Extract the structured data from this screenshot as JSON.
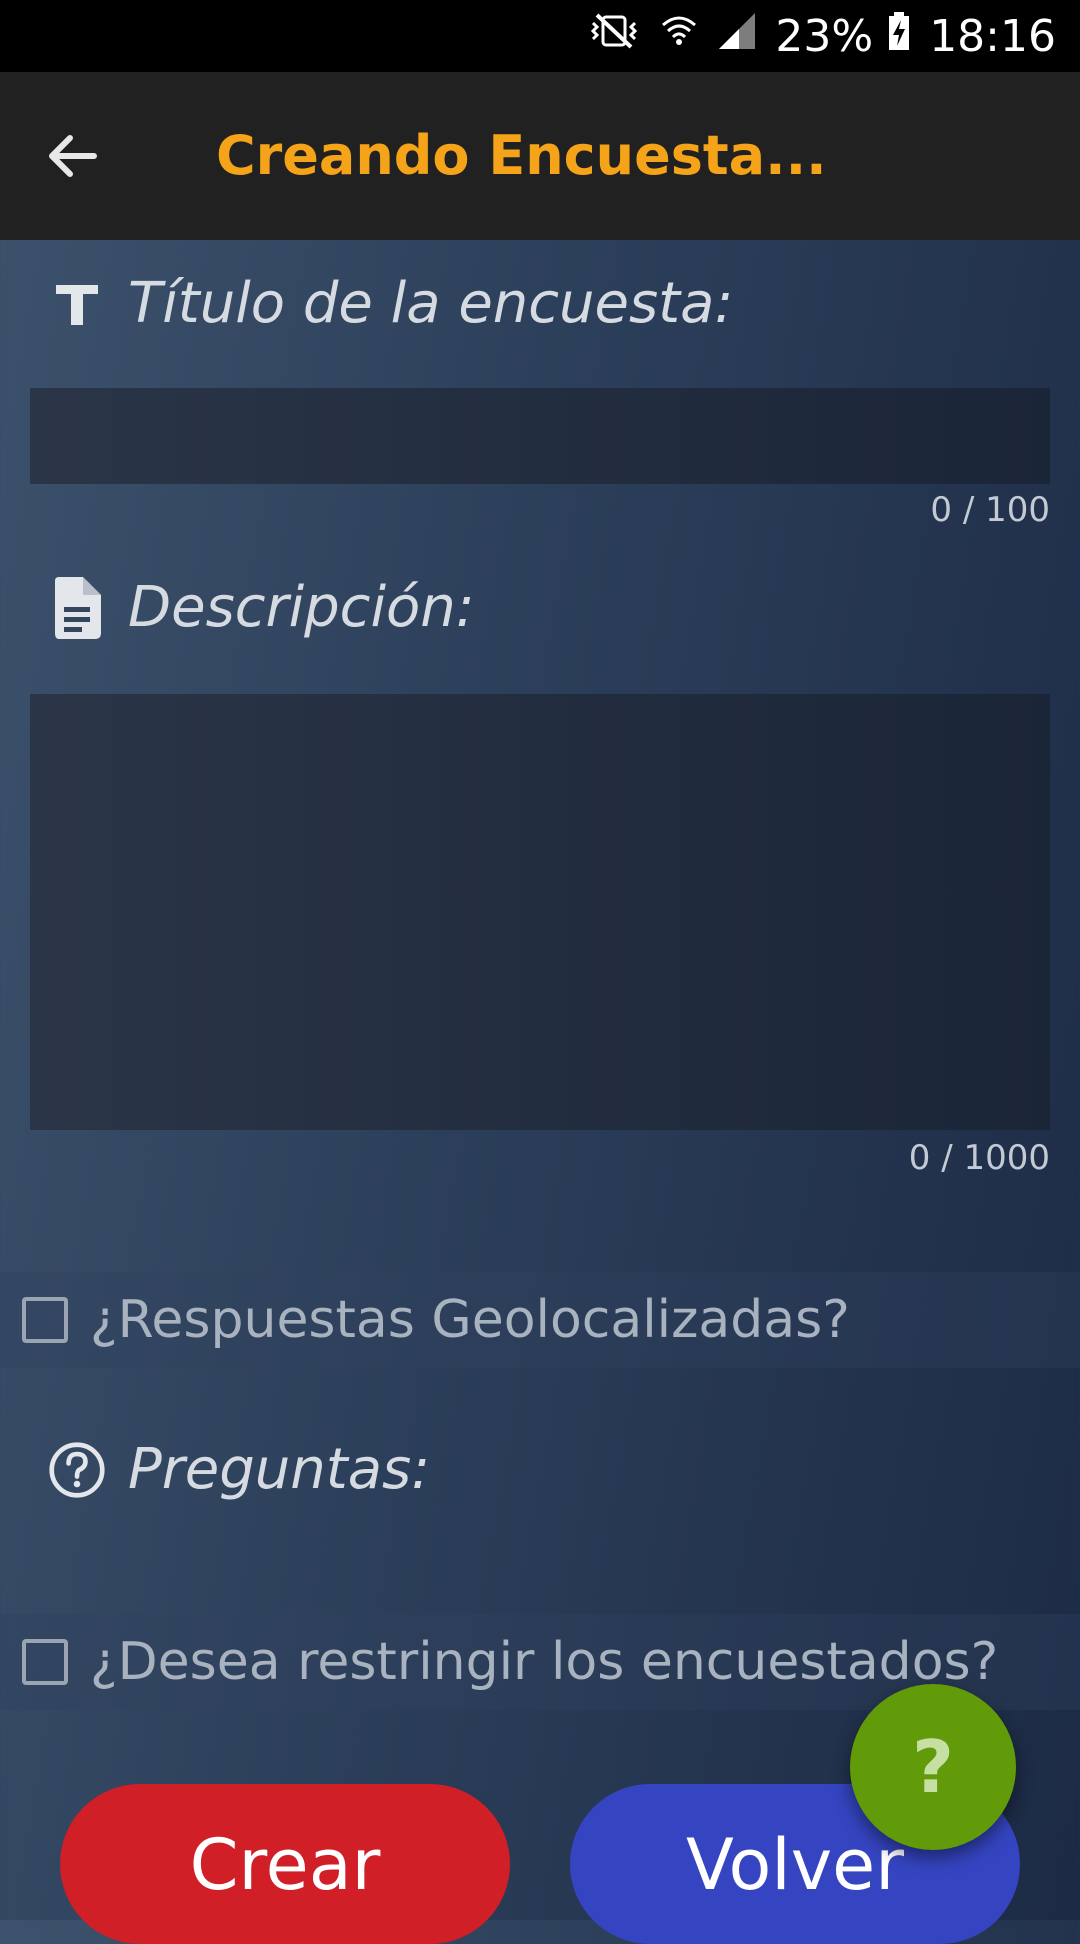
{
  "status_bar": {
    "battery": "23%",
    "time": "18:16"
  },
  "app_bar": {
    "title": "Creando Encuesta..."
  },
  "form": {
    "title_label": "Título de la encuesta:",
    "title_value": "",
    "title_counter": "0 / 100",
    "description_label": "Descripción:",
    "description_value": "",
    "description_counter": "0 / 1000",
    "geo_checkbox_label": "¿Respuestas Geolocalizadas?",
    "questions_label": "Preguntas:",
    "restrict_checkbox_label": "¿Desea restringir los encuestados?"
  },
  "buttons": {
    "create": "Crear",
    "back": "Volver",
    "help": "?"
  },
  "colors": {
    "accent": "#f5a319",
    "create_button": "#d01f27",
    "back_button": "#3545c2",
    "help_fab": "#629b0a"
  }
}
